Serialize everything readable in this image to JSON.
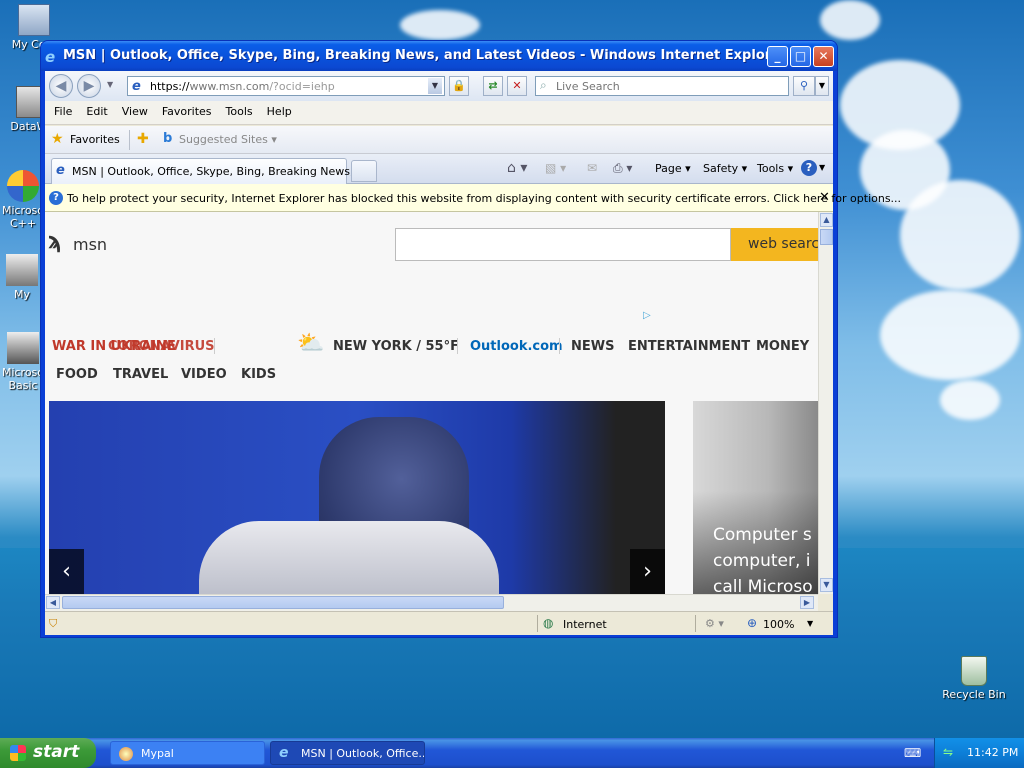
{
  "desktop": {
    "icons": [
      {
        "label": "My Com"
      },
      {
        "label": "DataWa"
      },
      {
        "label": "Microso C++"
      },
      {
        "label": "My"
      },
      {
        "label": "Microso Basic"
      },
      {
        "label": "Recycle Bin"
      }
    ]
  },
  "window": {
    "title": "MSN | Outlook, Office, Skype, Bing, Breaking News, and Latest Videos - Windows Internet Explorer",
    "minimize_label": "_",
    "maximize_label": "□",
    "close_label": "✕"
  },
  "address": {
    "url_prefix": "https://",
    "url_host": "www.msn.com",
    "url_rest": "/?ocid=iehp",
    "search_placeholder": "Live Search"
  },
  "menu": [
    "File",
    "Edit",
    "View",
    "Favorites",
    "Tools",
    "Help"
  ],
  "favorites": {
    "label": "Favorites",
    "suggested": "Suggested Sites"
  },
  "tab": {
    "title": "MSN | Outlook, Office, Skype, Bing, Breaking News, a...",
    "commands": {
      "page": "Page",
      "safety": "Safety",
      "tools": "Tools"
    }
  },
  "infobar": {
    "text": "To help protect your security, Internet Explorer has blocked this website from displaying content with security certificate errors. Click here for options..."
  },
  "msn": {
    "logo": "msn",
    "search_button": "web search",
    "nav_red_1": "WAR IN UKRAINE",
    "nav_red_2": "CORONAVIRUS",
    "weather": "NEW YORK / 55°F",
    "outlook": "Outlook.com",
    "row1": [
      "NEWS",
      "ENTERTAINMENT",
      "MONEY"
    ],
    "row2": [
      "FOOD",
      "TRAVEL",
      "VIDEO",
      "KIDS"
    ],
    "side_caption_lines": [
      "Computer s",
      "computer, i",
      "call Microso"
    ]
  },
  "status": {
    "zone": "Internet",
    "zoom": "100%"
  },
  "taskbar": {
    "start": "start",
    "tasks": [
      "Mypal",
      "MSN | Outlook, Office...."
    ],
    "clock": "11:42 PM"
  },
  "colors": {
    "msn_search_button": "#f3b61f",
    "nav_red": "#c0392b",
    "outlook_blue": "#0067b8"
  }
}
